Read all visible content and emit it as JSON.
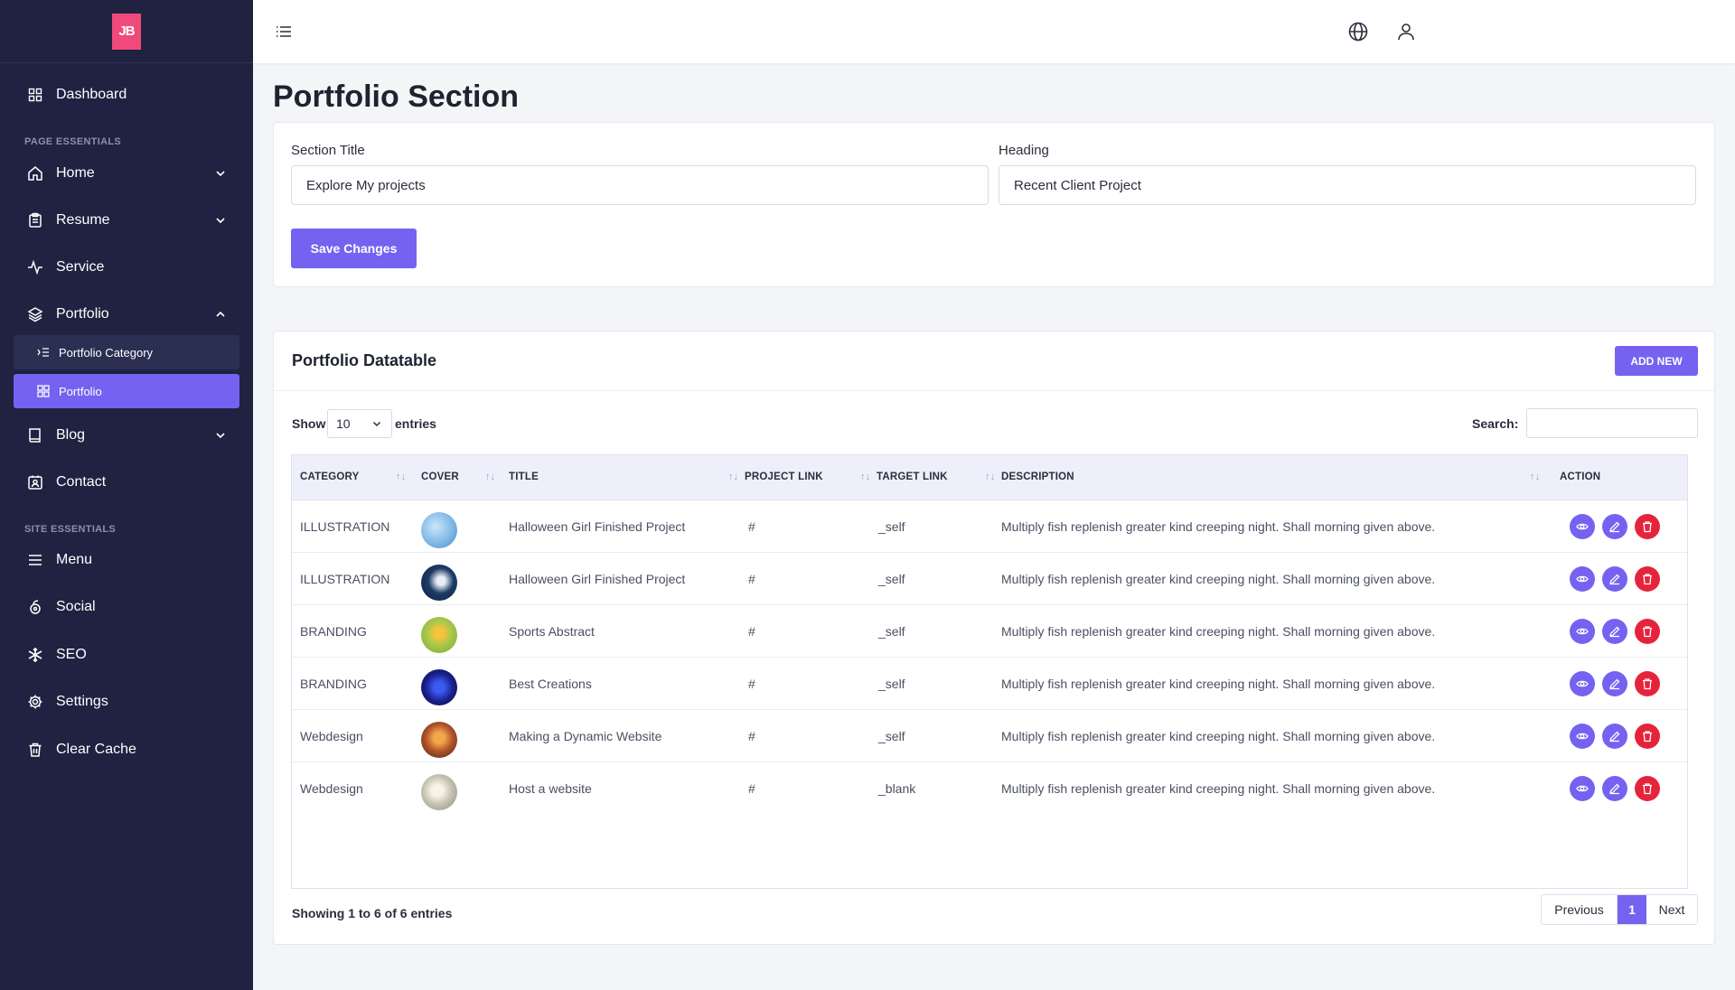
{
  "sidebar": {
    "logo_text": "JB",
    "dashboard": "Dashboard",
    "page_essentials": "PAGE ESSENTIALS",
    "home": "Home",
    "resume": "Resume",
    "service": "Service",
    "portfolio": "Portfolio",
    "portfolio_category": "Portfolio Category",
    "portfolio_sub": "Portfolio",
    "blog": "Blog",
    "contact": "Contact",
    "site_essentials": "SITE ESSENTIALS",
    "menu": "Menu",
    "social": "Social",
    "seo": "SEO",
    "settings": "Settings",
    "clear_cache": "Clear Cache"
  },
  "page": {
    "title": "Portfolio Section"
  },
  "form": {
    "section_title_label": "Section Title",
    "section_title_value": "Explore My projects",
    "heading_label": "Heading",
    "heading_value": "Recent Client Project",
    "save_label": "Save Changes"
  },
  "datatable": {
    "title": "Portfolio Datatable",
    "add_new": "ADD NEW",
    "show_label": "Show",
    "show_value": "10",
    "entries_label": "entries",
    "search_label": "Search:",
    "columns": {
      "category": "CATEGORY",
      "cover": "COVER",
      "title": "TITLE",
      "project_link": "PROJECT LINK",
      "target_link": "TARGET LINK",
      "description": "DESCRIPTION",
      "action": "ACTION"
    },
    "rows": [
      {
        "category": "ILLUSTRATION",
        "title": "Halloween Girl Finished Project",
        "project_link": "#",
        "target_link": "_self",
        "description": "Multiply fish replenish greater kind creeping night. Shall morning given above."
      },
      {
        "category": "ILLUSTRATION",
        "title": "Halloween Girl Finished Project",
        "project_link": "#",
        "target_link": "_self",
        "description": "Multiply fish replenish greater kind creeping night. Shall morning given above."
      },
      {
        "category": "BRANDING",
        "title": "Sports Abstract",
        "project_link": "#",
        "target_link": "_self",
        "description": "Multiply fish replenish greater kind creeping night. Shall morning given above."
      },
      {
        "category": "BRANDING",
        "title": "Best Creations",
        "project_link": "#",
        "target_link": "_self",
        "description": "Multiply fish replenish greater kind creeping night. Shall morning given above."
      },
      {
        "category": "Webdesign",
        "title": "Making a Dynamic Website",
        "project_link": "#",
        "target_link": "_self",
        "description": "Multiply fish replenish greater kind creeping night. Shall morning given above."
      },
      {
        "category": "Webdesign",
        "title": "Host a website",
        "project_link": "#",
        "target_link": "_blank",
        "description": "Multiply fish replenish greater kind creeping night. Shall morning given above."
      }
    ],
    "showing": "Showing 1 to 6 of 6 entries",
    "pagination": {
      "previous": "Previous",
      "current": "1",
      "next": "Next"
    }
  },
  "colors": {
    "sidebar_bg": "#1f2240",
    "accent": "#7662f0",
    "logo": "#ef4a7b",
    "danger": "#e5243b"
  }
}
